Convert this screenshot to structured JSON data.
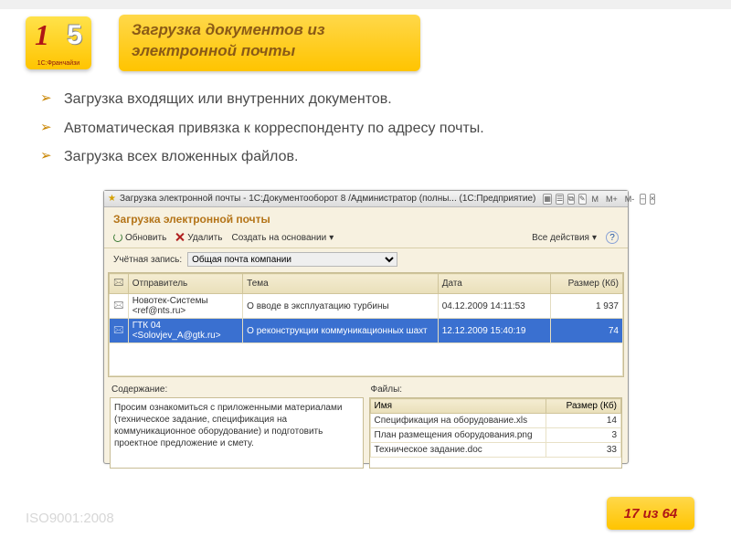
{
  "logo": {
    "sub": "1С:Франчайзи"
  },
  "slide_title": "Загрузка документов из электронной почты",
  "bullets": [
    "Загрузка входящих или внутренних документов.",
    "Автоматическая привязка к корреспонденту по адресу почты.",
    "Загрузка всех вложенных файлов."
  ],
  "window": {
    "title": "Загрузка электронной почты - 1С:Документооборот 8 /Администратор (полны...  (1С:Предприятие)",
    "icons": {
      "m": "M",
      "mplus": "M+",
      "mminus": "M-"
    },
    "section_title": "Загрузка электронной почты",
    "toolbar": {
      "refresh": "Обновить",
      "delete": "Удалить",
      "create_from": "Создать на основании",
      "all_actions": "Все действия",
      "help": "?"
    },
    "account_label": "Учётная запись:",
    "account_value": "Общая почта компании",
    "grid": {
      "headers": {
        "sender": "Отправитель",
        "subject": "Тема",
        "date": "Дата",
        "size": "Размер (Кб)"
      },
      "rows": [
        {
          "sender": "Новотек-Системы <ref@nts.ru>",
          "subject": "О вводе в эксплуатацию турбины",
          "date": "04.12.2009 14:11:53",
          "size": "1 937"
        },
        {
          "sender": "ГТК 04 <Solovjev_A@gtk.ru>",
          "subject": "О реконструкции коммуникационных шахт",
          "date": "12.12.2009 15:40:19",
          "size": "74"
        }
      ]
    },
    "content_label": "Содержание:",
    "content_text": "Просим ознакомиться с приложенными материалами (техническое задание, спецификация на коммуникационное оборудование) и подготовить проектное предложение и смету.",
    "files_label": "Файлы:",
    "files_grid": {
      "headers": {
        "name": "Имя",
        "size": "Размер (Кб)"
      },
      "rows": [
        {
          "name": "Спецификация на оборудование.xls",
          "size": "14",
          "selected": true
        },
        {
          "name": "План размещения оборудования.png",
          "size": "3"
        },
        {
          "name": "Техническое задание.doc",
          "size": "33"
        }
      ]
    }
  },
  "footer": {
    "iso": "ISO9001:2008",
    "page": "17 из 64"
  }
}
